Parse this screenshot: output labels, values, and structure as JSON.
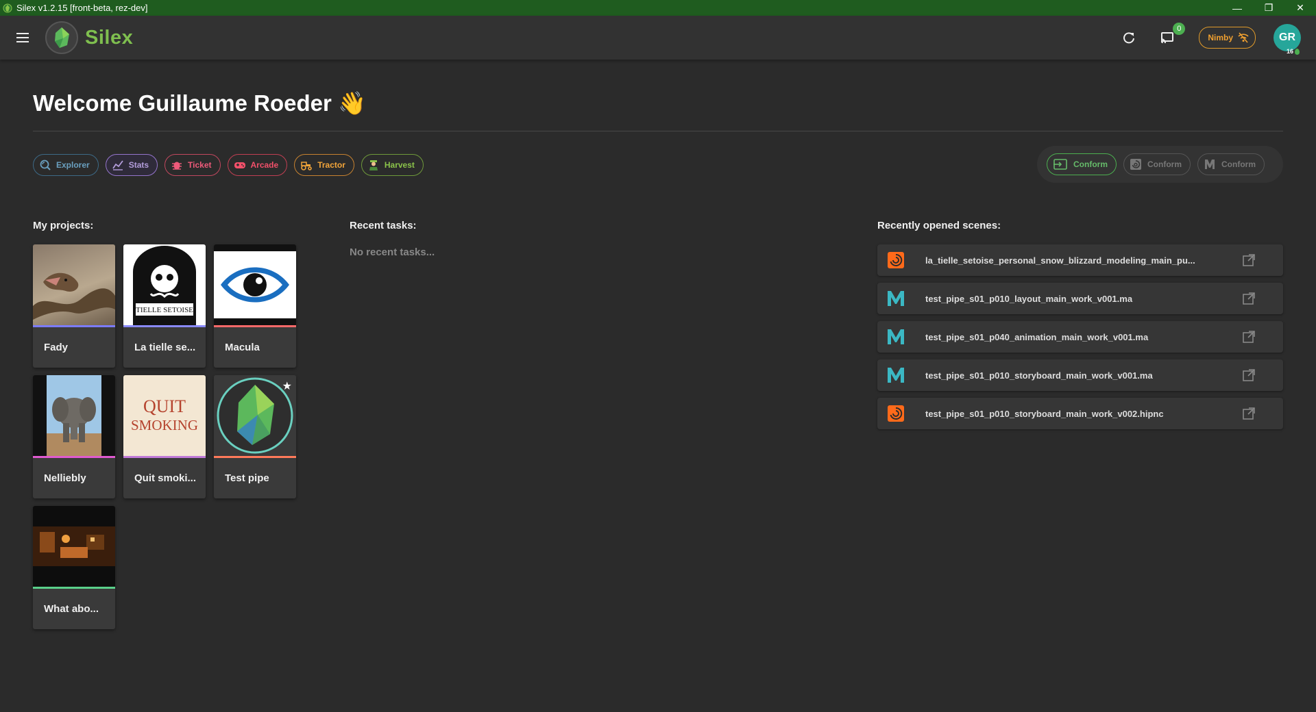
{
  "window": {
    "title": "Silex v1.2.15 [front-beta, rez-dev]",
    "minimize_glyph": "—",
    "restore_glyph": "❐",
    "close_glyph": "✕"
  },
  "appbar": {
    "brand": "Silex",
    "notifications_count": "0",
    "nimby_label": "Nimby",
    "avatar_initials": "GR",
    "avatar_level": "16"
  },
  "welcome": {
    "title": "Welcome Guillaume Roeder 👋"
  },
  "apps": [
    {
      "label": "Explorer",
      "icon": "explorer-icon"
    },
    {
      "label": "Stats",
      "icon": "stats-icon"
    },
    {
      "label": "Ticket",
      "icon": "bug-icon"
    },
    {
      "label": "Arcade",
      "icon": "gamepad-icon"
    },
    {
      "label": "Tractor",
      "icon": "tractor-icon"
    },
    {
      "label": "Harvest",
      "icon": "farmer-icon"
    }
  ],
  "conform": [
    {
      "label": "Conform",
      "icon": "conform-icon",
      "active": true
    },
    {
      "label": "Conform",
      "icon": "houdini-icon",
      "active": false
    },
    {
      "label": "Conform",
      "icon": "maya-icon",
      "active": false
    }
  ],
  "projects": {
    "heading": "My projects:",
    "items": [
      {
        "name": "Fady",
        "accent": "#7b7bff"
      },
      {
        "name": "La tielle se...",
        "accent": "#8a8aff"
      },
      {
        "name": "Macula",
        "accent": "#ff6a6a"
      },
      {
        "name": "Nelliebly",
        "accent": "#e05ad0"
      },
      {
        "name": "Quit smoki...",
        "accent": "#c07ad8"
      },
      {
        "name": "Test pipe",
        "accent": "#ff7a5a",
        "starred": true
      },
      {
        "name": "What abo...",
        "accent": "#5ad08a"
      }
    ],
    "thumb_text": {
      "tielle": "TIELLE SETOISE",
      "quit_line1": "QUIT",
      "quit_line2": "SMOKING"
    }
  },
  "tasks": {
    "heading": "Recent tasks:",
    "empty": "No recent tasks..."
  },
  "scenes": {
    "heading": "Recently opened scenes:",
    "items": [
      {
        "name": "la_tielle_setoise_personal_snow_blizzard_modeling_main_pu...",
        "app": "houdini"
      },
      {
        "name": "test_pipe_s01_p010_layout_main_work_v001.ma",
        "app": "maya"
      },
      {
        "name": "test_pipe_s01_p040_animation_main_work_v001.ma",
        "app": "maya"
      },
      {
        "name": "test_pipe_s01_p010_storyboard_main_work_v001.ma",
        "app": "maya"
      },
      {
        "name": "test_pipe_s01_p010_storyboard_main_work_v002.hipnc",
        "app": "houdini"
      }
    ]
  }
}
